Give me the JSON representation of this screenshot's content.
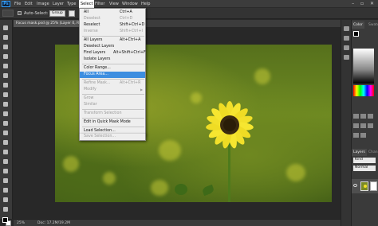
{
  "menubar": {
    "logo": "Ps",
    "items": [
      "File",
      "Edit",
      "Image",
      "Layer",
      "Type",
      "Select",
      "Filter",
      "View",
      "Window",
      "Help"
    ],
    "active_index": 5,
    "window_controls": "– ▫ ✕"
  },
  "options": {
    "auto_select_label": "Auto-Select:",
    "auto_select_value": "Group"
  },
  "document": {
    "tab_title": "Focus mask.psd @ 25% (Layer 0, RGB/8)"
  },
  "status": {
    "zoom": "25%",
    "doc_info": "Doc: 17.2M/19.2M"
  },
  "panels": {
    "color_tab": "Color",
    "swatches_tab": "Swatch",
    "layers_tab": "Layers",
    "channels_tab": "Chan",
    "kind_label": "Kind",
    "blend_mode": "Normal"
  },
  "select_menu": {
    "items": [
      {
        "label": "All",
        "shortcut": "Ctrl+A",
        "state": "enabled"
      },
      {
        "label": "Deselect",
        "shortcut": "Ctrl+D",
        "state": "disabled"
      },
      {
        "label": "Reselect",
        "shortcut": "Shift+Ctrl+D",
        "state": "enabled"
      },
      {
        "label": "Inverse",
        "shortcut": "Shift+Ctrl+I",
        "state": "disabled"
      },
      {
        "label": "All Layers",
        "shortcut": "Alt+Ctrl+A",
        "state": "enabled"
      },
      {
        "label": "Deselect Layers",
        "shortcut": "",
        "state": "enabled"
      },
      {
        "label": "Find Layers",
        "shortcut": "Alt+Shift+Ctrl+F",
        "state": "enabled"
      },
      {
        "label": "Isolate Layers",
        "shortcut": "",
        "state": "enabled"
      },
      {
        "label": "Color Range...",
        "shortcut": "",
        "state": "enabled"
      },
      {
        "label": "Focus Area...",
        "shortcut": "",
        "state": "highlighted"
      },
      {
        "label": "Refine Mask...",
        "shortcut": "Alt+Ctrl+R",
        "state": "disabled"
      },
      {
        "label": "Modify",
        "shortcut": "",
        "state": "disabled"
      },
      {
        "label": "Grow",
        "shortcut": "",
        "state": "disabled"
      },
      {
        "label": "Similar",
        "shortcut": "",
        "state": "disabled"
      },
      {
        "label": "Transform Selection",
        "shortcut": "",
        "state": "disabled"
      },
      {
        "label": "Edit in Quick Mask Mode",
        "shortcut": "",
        "state": "enabled"
      },
      {
        "label": "Load Selection...",
        "shortcut": "",
        "state": "enabled"
      },
      {
        "label": "Save Selection...",
        "shortcut": "",
        "state": "disabled"
      }
    ]
  },
  "colors": {
    "menu_highlight": "#3d8ee0",
    "sunflower_petal": "#f2e02a",
    "sunflower_center": "#3a2a10",
    "ps_blue": "#35a0ff"
  }
}
